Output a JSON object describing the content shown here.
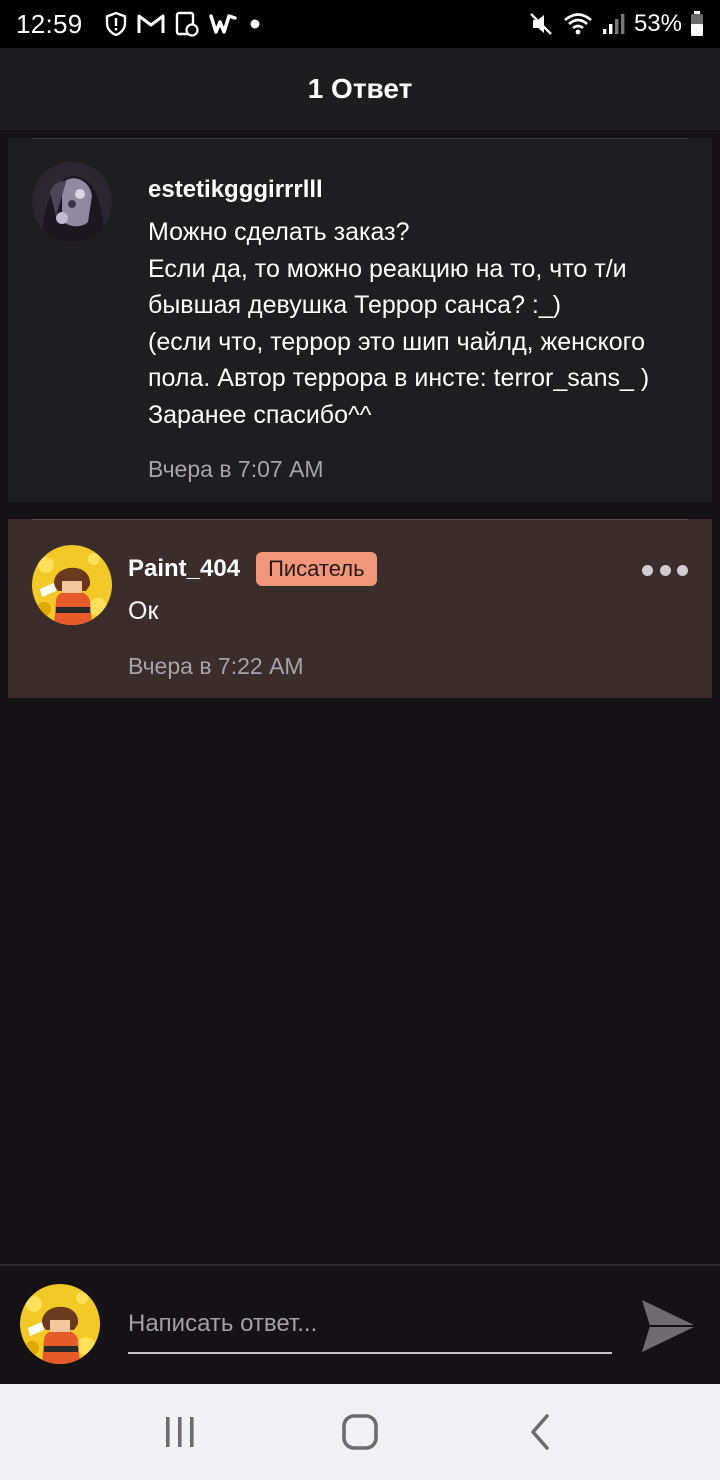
{
  "status_bar": {
    "time": "12:59",
    "battery": "53%",
    "left_icons": [
      "shield-icon",
      "gmail-icon",
      "notification-app-icon",
      "wattpad-icon",
      "dot-icon"
    ],
    "right_icons": [
      "mute-icon",
      "wifi-icon",
      "signal-icon",
      "battery-icon"
    ]
  },
  "header": {
    "title": "1 Ответ"
  },
  "comments": [
    {
      "username": "estetikgggirrrlll",
      "text": "Можно сделать заказ?\nЕсли да, то можно реакцию на то, что т/и\nбывшая девушка Террор санса? :_)\n(если что, террор это шип чайлд, женского\nпола. Автор террора в инсте: terror_sans_ )\nЗаранее спасибо^^",
      "time": "Вчера в 7:07 AM"
    },
    {
      "username": "Paint_404",
      "badge": "Писатель",
      "text": "Ок",
      "time": "Вчера в 7:22 AM"
    }
  ],
  "composer": {
    "placeholder": "Написать ответ..."
  },
  "colors": {
    "background": "#141215",
    "card": "#1e1d20",
    "reply_card": "#3b2d2b",
    "badge": "#f0967a",
    "muted_text": "#a6a4a8"
  }
}
